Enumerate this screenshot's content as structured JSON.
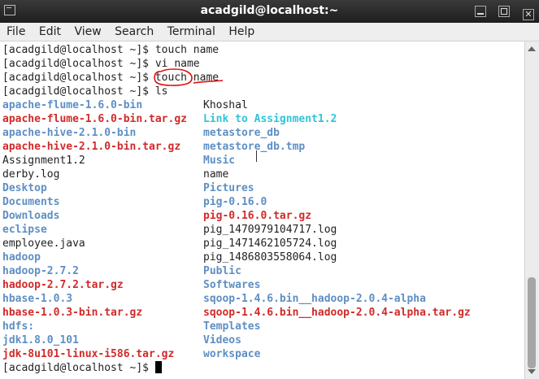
{
  "window": {
    "title": "acadgild@localhost:~",
    "close_glyph": "✕"
  },
  "menu": [
    "File",
    "Edit",
    "View",
    "Search",
    "Terminal",
    "Help"
  ],
  "commands": [
    {
      "prompt": "[acadgild@localhost ~]$ ",
      "cmd": "touch name"
    },
    {
      "prompt": "[acadgild@localhost ~]$ ",
      "cmd": "vi name"
    },
    {
      "prompt": "[acadgild@localhost ~]$ ",
      "cmd": "touch name"
    },
    {
      "prompt": "[acadgild@localhost ~]$ ",
      "cmd": "ls"
    }
  ],
  "ls_left": [
    {
      "text": "apache-flume-1.6.0-bin",
      "type": "dir"
    },
    {
      "text": "apache-flume-1.6.0-bin.tar.gz",
      "type": "arc"
    },
    {
      "text": "apache-hive-2.1.0-bin",
      "type": "dir"
    },
    {
      "text": "apache-hive-2.1.0-bin.tar.gz",
      "type": "arc"
    },
    {
      "text": "Assignment1.2",
      "type": "plain"
    },
    {
      "text": "derby.log",
      "type": "plain"
    },
    {
      "text": "Desktop",
      "type": "dir"
    },
    {
      "text": "Documents",
      "type": "dir"
    },
    {
      "text": "Downloads",
      "type": "dir"
    },
    {
      "text": "eclipse",
      "type": "dir"
    },
    {
      "text": "employee.java",
      "type": "plain"
    },
    {
      "text": "hadoop",
      "type": "dir"
    },
    {
      "text": "hadoop-2.7.2",
      "type": "dir"
    },
    {
      "text": "hadoop-2.7.2.tar.gz",
      "type": "arc"
    },
    {
      "text": "hbase-1.0.3",
      "type": "dir"
    },
    {
      "text": "hbase-1.0.3-bin.tar.gz",
      "type": "arc"
    },
    {
      "text": "hdfs:",
      "type": "dir"
    },
    {
      "text": "jdk1.8.0_101",
      "type": "dir"
    },
    {
      "text": "jdk-8u101-linux-i586.tar.gz",
      "type": "arc"
    }
  ],
  "ls_right": [
    {
      "text": "Khoshal",
      "type": "plain"
    },
    {
      "text": "Link to Assignment1.2",
      "type": "link"
    },
    {
      "text": "metastore_db",
      "type": "dir"
    },
    {
      "text": "metastore_db.tmp",
      "type": "dir"
    },
    {
      "text": "Music",
      "type": "dir"
    },
    {
      "text": "name",
      "type": "plain"
    },
    {
      "text": "Pictures",
      "type": "dir"
    },
    {
      "text": "pig-0.16.0",
      "type": "dir"
    },
    {
      "text": "pig-0.16.0.tar.gz",
      "type": "arc"
    },
    {
      "text": "pig_1470979104717.log",
      "type": "plain"
    },
    {
      "text": "pig_1471462105724.log",
      "type": "plain"
    },
    {
      "text": "pig_1486803558064.log",
      "type": "plain"
    },
    {
      "text": "Public",
      "type": "dir"
    },
    {
      "text": "Softwares",
      "type": "dir"
    },
    {
      "text": "sqoop-1.4.6.bin__hadoop-2.0.4-alpha",
      "type": "dir"
    },
    {
      "text": "sqoop-1.4.6.bin__hadoop-2.0.4-alpha.tar.gz",
      "type": "arc"
    },
    {
      "text": "Templates",
      "type": "dir"
    },
    {
      "text": "Videos",
      "type": "dir"
    },
    {
      "text": "workspace",
      "type": "dir"
    }
  ],
  "final_prompt": "[acadgild@localhost ~]$ ",
  "colors": {
    "directory": "#5e8fc4",
    "archive": "#d12a2a",
    "symlink": "#30c4d8",
    "annotation": "#e01010"
  },
  "icons": [
    "terminal-icon",
    "minimize-icon",
    "maximize-icon",
    "close-icon"
  ]
}
